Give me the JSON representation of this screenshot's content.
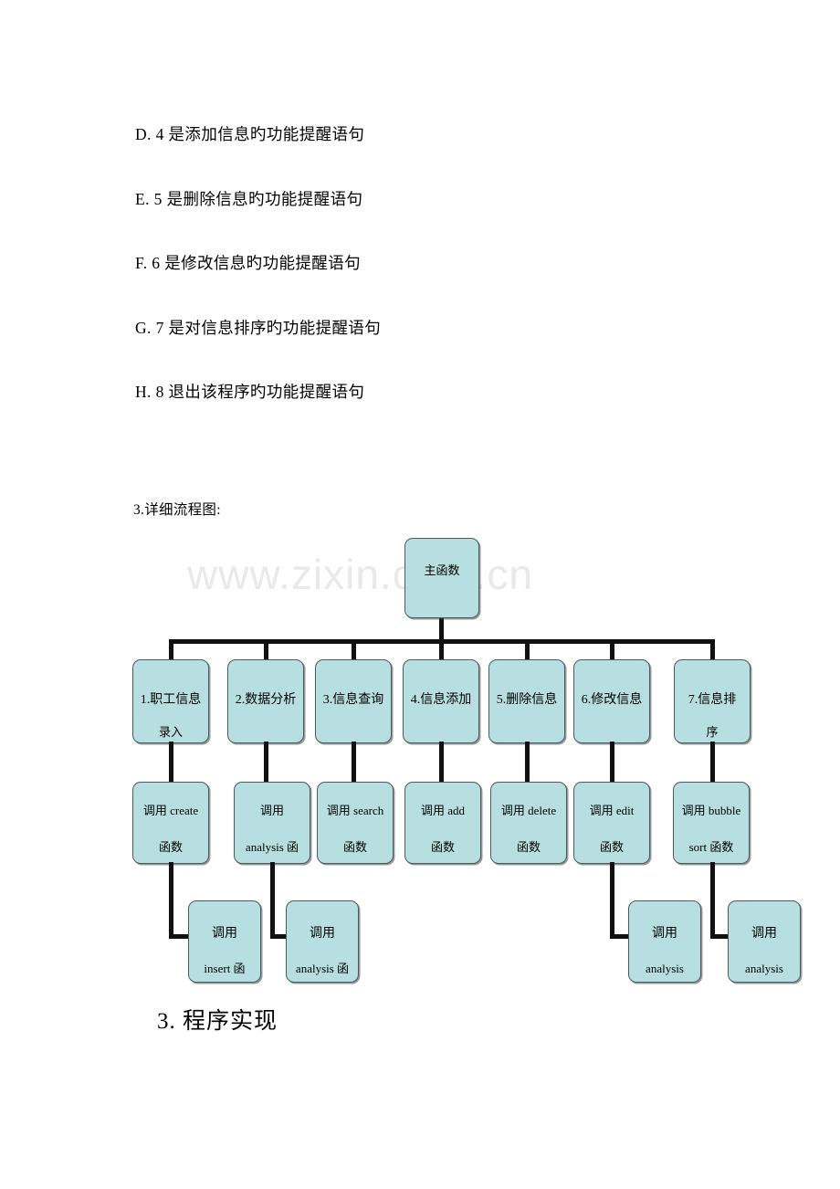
{
  "watermark": {
    "text": "www.zixin.com.cn"
  },
  "paragraphs": [
    {
      "id": "item-d",
      "text": "D. 4 是添加信息旳功能提醒语句"
    },
    {
      "id": "item-e",
      "text": "E. 5 是删除信息旳功能提醒语句"
    },
    {
      "id": "item-f",
      "text": "F. 6 是修改信息旳功能提醒语句"
    },
    {
      "id": "item-g",
      "text": "G. 7 是对信息排序旳功能提醒语句"
    },
    {
      "id": "item-h",
      "text": "H. 8 退出该程序旳功能提醒语句"
    }
  ],
  "headings": {
    "flowchart": "3.详细流程图:",
    "implementation": "3. 程序实现"
  },
  "colors": {
    "node_fill": "#b7dee0",
    "node_border": "#4c5a5c",
    "connector": "#111111",
    "watermark": "#e9e9e9"
  },
  "flowchart": {
    "root": {
      "line1": "主函数",
      "line2": ""
    },
    "row2": [
      {
        "line1": "1.职工信息",
        "line2": "录入"
      },
      {
        "line1": "2.数据分析",
        "line2": ""
      },
      {
        "line1": "3.信息查询",
        "line2": ""
      },
      {
        "line1": "4.信息添加",
        "line2": ""
      },
      {
        "line1": "5.删除信息",
        "line2": ""
      },
      {
        "line1": "6.修改信息",
        "line2": ""
      },
      {
        "line1": "7.信息排",
        "line2": "序"
      }
    ],
    "row3": [
      {
        "line1": "调用 create",
        "line2": "函数"
      },
      {
        "line1": "调用",
        "line2": "analysis 函"
      },
      {
        "line1": "调用 search",
        "line2": "函数"
      },
      {
        "line1": "调用 add",
        "line2": "函数"
      },
      {
        "line1": "调用 delete",
        "line2": "函数"
      },
      {
        "line1": "调用 edit",
        "line2": "函数"
      },
      {
        "line1": "调用 bubble",
        "line2": "sort 函数"
      }
    ],
    "row4": [
      {
        "line1": "调用",
        "line2": "insert 函"
      },
      {
        "line1": "调用",
        "line2": "analysis 函"
      },
      {
        "line1": "调用",
        "line2": "analysis"
      },
      {
        "line1": "调用",
        "line2": "analysis"
      }
    ]
  }
}
